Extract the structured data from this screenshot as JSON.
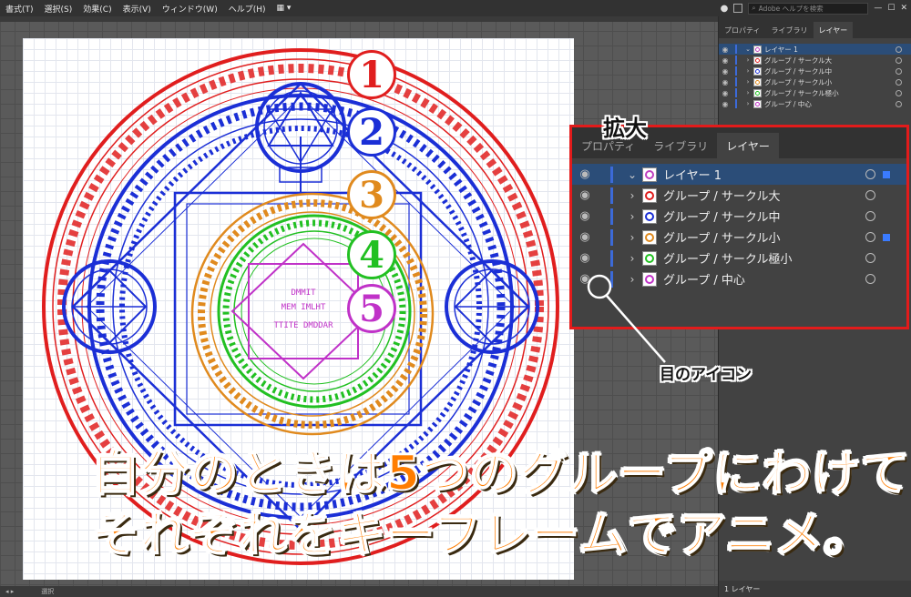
{
  "menubar": {
    "items": [
      "書式(T)",
      "選択(S)",
      "効果(C)",
      "表示(V)",
      "ウィンドウ(W)",
      "ヘルプ(H)"
    ],
    "search_placeholder": "Adobe ヘルプを検索"
  },
  "status": {
    "mode": "選択"
  },
  "panel": {
    "tabs": [
      "プロパティ",
      "ライブラリ",
      "レイヤー"
    ],
    "layers": [
      {
        "label": "レイヤー 1",
        "color": "#c040c0"
      },
      {
        "label": "グループ / サークル大",
        "color": "#e01e1e"
      },
      {
        "label": "グループ / サークル中",
        "color": "#1b2fd6"
      },
      {
        "label": "グループ / サークル小",
        "color": "#e08a1e"
      },
      {
        "label": "グループ / サークル極小",
        "color": "#22c022"
      },
      {
        "label": "グループ / 中心",
        "color": "#c032c8"
      }
    ],
    "footer": "1 レイヤー"
  },
  "zoom": {
    "title": "拡大",
    "tabs": [
      "プロパティ",
      "ライブラリ",
      "レイヤー"
    ],
    "layers": [
      {
        "label": "レイヤー 1",
        "color": "#c040c0"
      },
      {
        "label": "グループ / サークル大",
        "color": "#e01e1e"
      },
      {
        "label": "グループ / サークル中",
        "color": "#1b2fd6"
      },
      {
        "label": "グループ / サークル小",
        "color": "#e08a1e"
      },
      {
        "label": "グループ / サークル極小",
        "color": "#22c022"
      },
      {
        "label": "グループ / 中心",
        "color": "#c032c8"
      }
    ]
  },
  "eye_annotation": "目のアイコン",
  "caption": {
    "line1": "自分のときは5つのグループにわけて",
    "line2": "それぞれをキーフレームでアニメ。"
  },
  "badges": [
    {
      "label": "1",
      "color": "#e01e1e"
    },
    {
      "label": "2",
      "color": "#1b2fd6"
    },
    {
      "label": "3",
      "color": "#e08a1e"
    },
    {
      "label": "4",
      "color": "#22c022"
    },
    {
      "label": "5",
      "color": "#c032c8"
    }
  ],
  "artwork_text": {
    "line1": "DMMIT",
    "line2": "MEM IMLHT",
    "line3": "TTITE DMDDAR"
  }
}
